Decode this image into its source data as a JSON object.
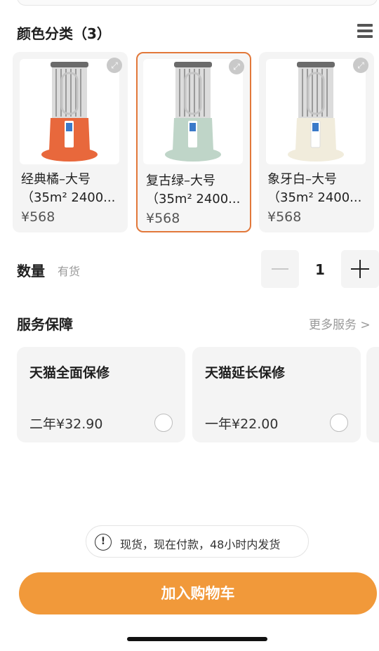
{
  "colors": {
    "accent_orange": "#f1993a",
    "selected_border": "#e2783a",
    "card_bg": "#f4f4f4",
    "heater_orange": "#e8683c",
    "heater_green": "#bfd5c8",
    "heater_ivory": "#f1ecdc"
  },
  "color_section": {
    "title": "颜色分类（3）",
    "menu_icon": "list-icon",
    "variants": [
      {
        "name": "经典橘–大号",
        "spec": "（35m² 2400...",
        "price": "¥568",
        "color": "heater_orange",
        "selected": false,
        "icon": "expand-icon"
      },
      {
        "name": "复古绿–大号",
        "spec": "（35m² 2400...",
        "price": "¥568",
        "color": "heater_green",
        "selected": true,
        "icon": "expand-icon"
      },
      {
        "name": "象牙白–大号",
        "spec": "（35m² 2400...",
        "price": "¥568",
        "color": "heater_ivory",
        "selected": false,
        "icon": "expand-icon"
      }
    ]
  },
  "quantity": {
    "title": "数量",
    "stock": "有货",
    "value": "1",
    "minus_icon": "minus-icon",
    "plus_icon": "plus-icon"
  },
  "services": {
    "title": "服务保障",
    "more": "更多服务 >",
    "items": [
      {
        "name": "天猫全面保修",
        "price": "二年¥32.90",
        "selected": false
      },
      {
        "name": "天猫延长保修",
        "price": "一年¥22.00",
        "selected": false
      }
    ]
  },
  "notice": {
    "icon": "exclamation-icon",
    "text": "现货，现在付款，48小时内发货"
  },
  "cart_button": "加入购物车"
}
